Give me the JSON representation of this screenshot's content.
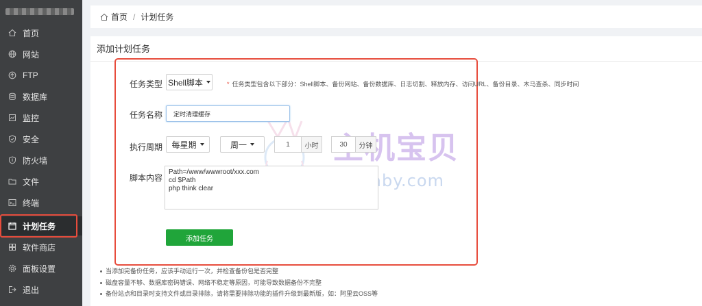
{
  "sidebar": {
    "items": [
      {
        "label": "首页",
        "icon": "home-icon"
      },
      {
        "label": "网站",
        "icon": "globe-icon"
      },
      {
        "label": "FTP",
        "icon": "ftp-icon"
      },
      {
        "label": "数据库",
        "icon": "database-icon"
      },
      {
        "label": "监控",
        "icon": "monitor-icon"
      },
      {
        "label": "安全",
        "icon": "shield-icon"
      },
      {
        "label": "防火墙",
        "icon": "firewall-icon"
      },
      {
        "label": "文件",
        "icon": "folder-icon"
      },
      {
        "label": "终端",
        "icon": "terminal-icon"
      },
      {
        "label": "计划任务",
        "icon": "calendar-icon",
        "active": true
      },
      {
        "label": "软件商店",
        "icon": "store-icon"
      },
      {
        "label": "面板设置",
        "icon": "gear-icon"
      },
      {
        "label": "退出",
        "icon": "logout-icon"
      }
    ]
  },
  "breadcrumb": {
    "home": "首页",
    "separator": "/",
    "current": "计划任务"
  },
  "panel": {
    "title": "添加计划任务"
  },
  "form": {
    "task_type_label": "任务类型",
    "task_type_value": "Shell脚本",
    "task_type_hint_star": "*",
    "task_type_hint": "任务类型包含以下部分：Shell脚本、备份网站、备份数据库、日志切割、释放内存、访问URL、备份目录、木马查杀、同步时间",
    "task_name_label": "任务名称",
    "task_name_value": "定时清理缓存",
    "cycle_label": "执行周期",
    "cycle_type": "每星期",
    "cycle_weekday": "周一",
    "hour_value": "1",
    "hour_unit": "小时",
    "minute_value": "30",
    "minute_unit": "分钟",
    "script_label": "脚本内容",
    "script_lines": [
      "Path=/www/wwwroot/xxx.com",
      "cd $Path",
      "php think clear"
    ],
    "submit_label": "添加任务"
  },
  "notes": [
    "当添加完备份任务，应该手动运行一次，并检查备份包是否完整",
    "磁盘容量不够、数据库密码错误、网络不稳定等原因，可能导致数据备份不完整",
    "备份站点和目录时支持文件或目录排除，请将需要排除功能的插件升级到最新版，如：阿里云OSS等"
  ],
  "watermark": {
    "text": "主机宝贝",
    "sub": "idcbaby.com"
  },
  "colors": {
    "sidebar_bg": "#3e4042",
    "accent_green": "#20a53a",
    "highlight_red": "#e74c3c"
  }
}
